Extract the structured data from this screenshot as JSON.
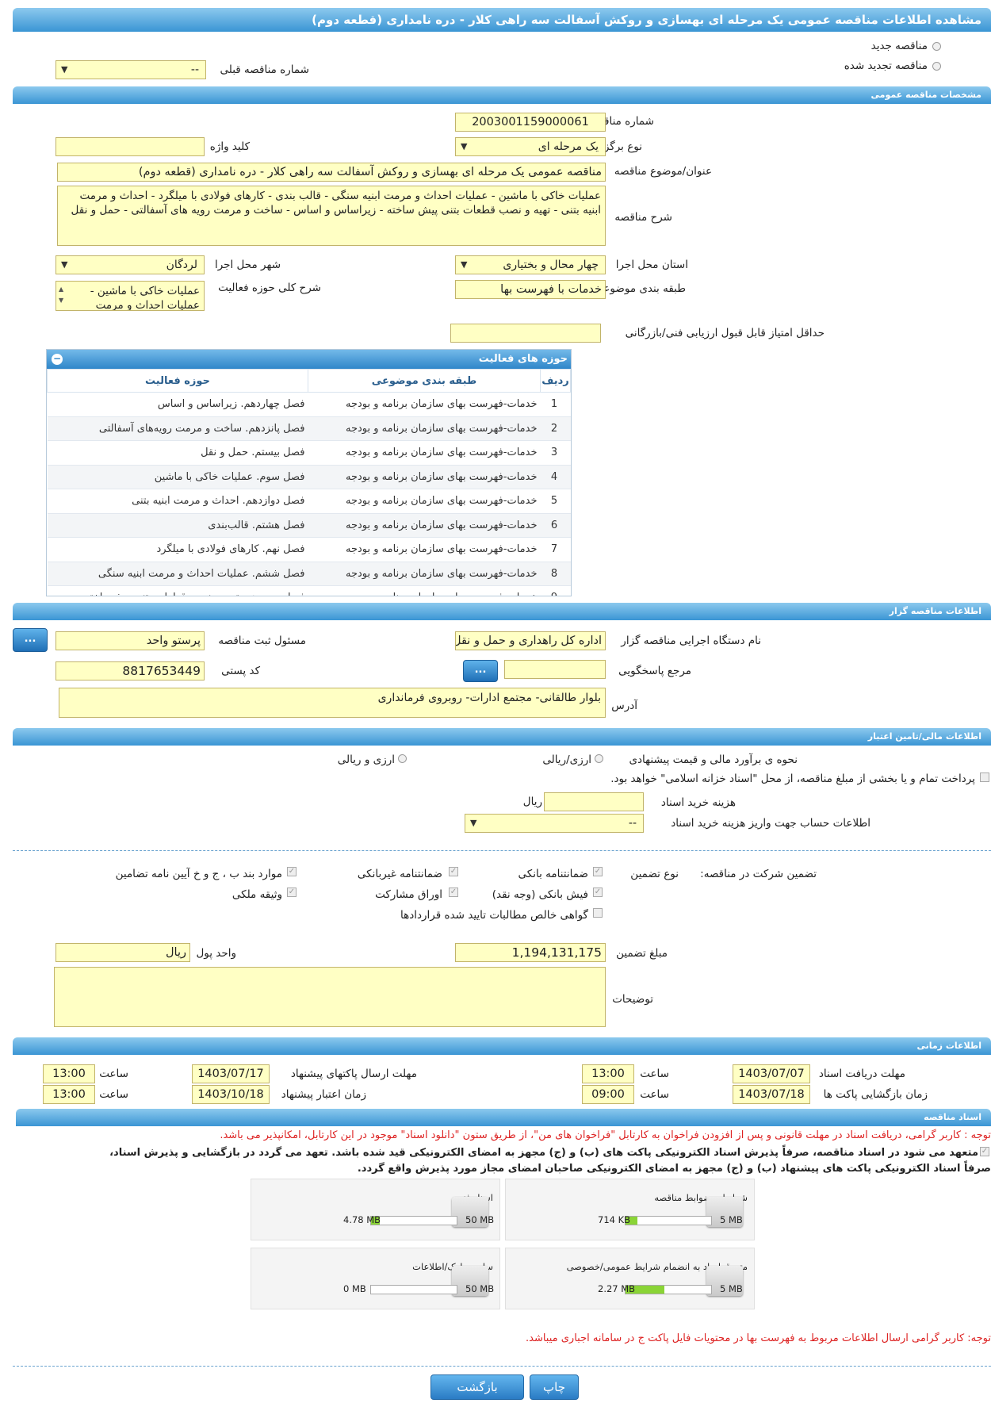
{
  "title": "مشاهده اطلاعات مناقصه عمومی یک مرحله ای بهسازی و روکش آسفالت سه راهی کلار - دره نامداری (قطعه دوم)",
  "top": {
    "new_tender": "مناقصه جدید",
    "renewed_tender": "مناقصه تجدید شده",
    "previous_no_label": "شماره مناقصه قبلی",
    "previous_no_value": "--"
  },
  "sections": {
    "general": "مشخصات مناقصه عمومی",
    "organizer": "اطلاعات مناقصه گزار",
    "financial": "اطلاعات مالی/تامین اعتبار",
    "timing": "اطلاعات زمانی",
    "documents": "اسناد مناقصه"
  },
  "general": {
    "tender_no_label": "شماره مناقصه",
    "tender_no": "2003001159000061",
    "type_label": "نوع برگزاری",
    "type_value": "یک مرحله ای",
    "keyword_label": "کلید واژه",
    "subject_label": "عنوان/موضوع مناقصه",
    "subject_value": "مناقصه عمومی یک مرحله ای بهسازی و روکش آسفالت سه راهی کلار - دره نامداری (قطعه دوم)",
    "desc_label": "شرح مناقصه",
    "desc_value": "عملیات خاکی با ماشین - عملیات احداث و مرمت ابنیه سنگی - قالب بندی - کارهای فولادی با میلگرد - احداث و مرمت ابنیه بتنی - تهیه و نصب قطعات بتنی پیش ساخته - زیراساس و اساس - ساخت و مرمت رویه های آسفالتی - حمل و نقل",
    "province_label": "استان محل اجرا",
    "province_value": "چهار محال و بختیاری",
    "city_label": "شهر محل اجرا",
    "city_value": "لردگان",
    "category_label": "طبقه بندی موضوعی",
    "category_value": "خدمات با فهرست بها",
    "activity_label": "شرح کلی حوزه فعالیت",
    "activity_value": "عملیات خاکی با ماشین - عملیات احداث و مرمت",
    "min_score_label": "حداقل امتیاز قابل قبول ارزیابی فنی/بازرگانی"
  },
  "activity_table": {
    "title": "حوزه های فعالیت",
    "headers": [
      "ردیف",
      "طبقه بندی موضوعی",
      "حوزه فعالیت"
    ],
    "rows": [
      [
        "1",
        "خدمات-فهرست بهای سازمان برنامه و بودجه",
        "فصل چهاردهم. زیراساس و اساس"
      ],
      [
        "2",
        "خدمات-فهرست بهای سازمان برنامه و بودجه",
        "فصل پانزدهم. ساخت و مرمت رویه‌های آسفالتی"
      ],
      [
        "3",
        "خدمات-فهرست بهای سازمان برنامه و بودجه",
        "فصل بیستم. حمل و نقل"
      ],
      [
        "4",
        "خدمات-فهرست بهای سازمان برنامه و بودجه",
        "فصل سوم. عملیات خاکی با ماشین"
      ],
      [
        "5",
        "خدمات-فهرست بهای سازمان برنامه و بودجه",
        "فصل دوازدهم. احداث و مرمت ابنیه بتنی"
      ],
      [
        "6",
        "خدمات-فهرست بهای سازمان برنامه و بودجه",
        "فصل هشتم. قالب‌بندی"
      ],
      [
        "7",
        "خدمات-فهرست بهای سازمان برنامه و بودجه",
        "فصل نهم. کارهای فولادی با میلگرد"
      ],
      [
        "8",
        "خدمات-فهرست بهای سازمان برنامه و بودجه",
        "فصل ششم.  عملیات احداث و مرمت ابنیه سنگی"
      ],
      [
        "9",
        "خدمات-فهرست بهای سازمان برنامه و بودجه",
        "فصل سیزدهم. تهیه و نصب قطعات بتنی پیش‌ساخته"
      ]
    ]
  },
  "organizer": {
    "org_label": "نام دستگاه اجرایی مناقصه گزار",
    "org_value": "اداره کل راهداری و حمل و نقل",
    "officer_label": "مسئول ثبت مناقصه",
    "officer_value": "پرستو واحد",
    "ref_label": "مرجع پاسخگویی",
    "postal_label": "کد پستی",
    "postal_value": "8817653449",
    "address_label": "آدرس",
    "address_value": "بلوار طالقانی- مجتمع ادارات- روبروی فرمانداری",
    "dots": "..."
  },
  "financial": {
    "method_label": "نحوه ی برآورد مالی و قیمت پیشنهادی",
    "opt_rial": "ارزی/ریالی",
    "opt_fx": "ارزی و ریالی",
    "treasury_text": "پرداخت تمام و یا بخشی از مبلغ مناقصه، از محل \"اسناد خزانه اسلامی\" خواهد بود.",
    "doc_cost_label": "هزینه خرید اسناد",
    "doc_cost_unit": "ریال",
    "account_label": "اطلاعات حساب جهت واریز هزینه خرید اسناد",
    "account_value": "--",
    "guarantee_label": "تضمین شرکت در مناقصه:",
    "guarantee_type_label": "نوع تضمین",
    "g_bank": "ضمانتنامه بانکی",
    "g_nonbank": "ضمانتنامه غیربانکی",
    "g_clauses": "موارد بند ب ، ج و خ آیین نامه تضامین",
    "g_cash": "فیش بانکی (وجه نقد)",
    "g_bonds": "اوراق مشارکت",
    "g_property": "وثیقه ملکی",
    "g_claims": "گواهی خالص مطالبات تایید شده قراردادها",
    "amount_label": "مبلغ تضمین",
    "amount_value": "1,194,131,175",
    "currency_label": "واحد پول",
    "currency_value": "ریال",
    "notes_label": "توضیحات"
  },
  "timing": {
    "receive_label": "مهلت دریافت اسناد",
    "receive_date": "1403/07/07",
    "receive_time": "13:00",
    "send_label": "مهلت ارسال پاکتهای پیشنهاد",
    "send_date": "1403/07/17",
    "send_time": "13:00",
    "open_label": "زمان بازگشایی پاکت ها",
    "open_date": "1403/07/18",
    "open_time": "09:00",
    "valid_label": "زمان اعتبار پیشنهاد",
    "valid_date": "1403/10/18",
    "valid_time": "13:00",
    "time_label": "ساعت"
  },
  "documents": {
    "note1": "توجه : کاربر گرامی، دریافت اسناد در مهلت قانونی و پس از افزودن فراخوان به کارتابل \"فراخوان های من\"، از طریق ستون \"دانلود اسناد\" موجود در این کارتابل، امکانپذیر می باشد.",
    "commit1": "متعهد می شود در اسناد مناقصه، صرفاً پذیرش اسناد الکترونیکی پاکت های (ب) و (ج) مجهز به امضای الکترونیکی قید شده باشد. تعهد می گردد در بازگشایی و پذیرش اسناد،",
    "commit2": "صرفاً اسناد الکترونیکی پاکت های پیشنهاد (ب) و (ج) مجهز به امضای الکترونیکی صاحبان امضای مجاز مورد پذیرش واقع گردد.",
    "files": [
      {
        "name": "شرایط و ضوابط مناقصه",
        "size": "714 KB",
        "max": "5 MB",
        "fill": 0.14
      },
      {
        "name": "اسناد فنی",
        "size": "4.78 MB",
        "max": "50 MB",
        "fill": 0.1
      },
      {
        "name": "متن قرارداد به انضمام شرایط عمومی/خصوصی",
        "size": "2.27 MB",
        "max": "5 MB",
        "fill": 0.45
      },
      {
        "name": "سایر مدارک/اطلاعات",
        "size": "0 MB",
        "max": "50 MB",
        "fill": 0.0
      }
    ],
    "note2": "توجه: کاربر گرامی ارسال اطلاعات مربوط به فهرست بها در محتویات فایل پاکت ج در سامانه اجباری میباشد."
  },
  "buttons": {
    "print": "چاپ",
    "back": "بازگشت"
  },
  "colors": {
    "header": "#3a95d4",
    "input_bg": "#ffffc4",
    "note_red": "#d22222"
  }
}
